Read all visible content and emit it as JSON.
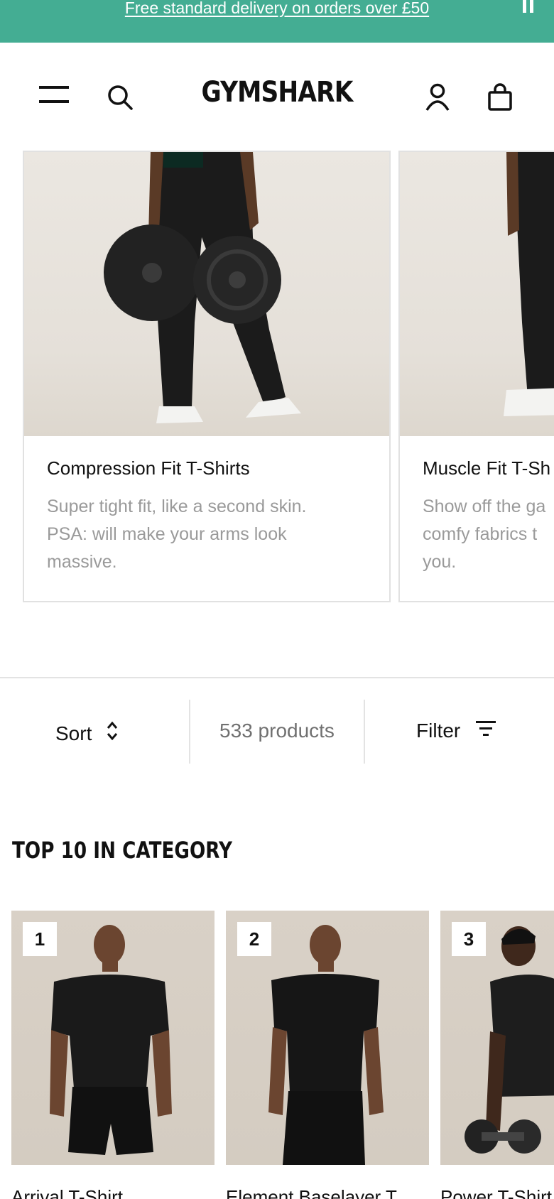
{
  "promo": {
    "text": "Free standard delivery on orders over £50"
  },
  "header": {
    "logo": "GYMSHARK"
  },
  "categories": [
    {
      "title": "Compression Fit T-Shirts",
      "desc": [
        "Super tight fit, like a second skin.",
        "PSA: will make your arms look",
        "massive."
      ]
    },
    {
      "title": "Muscle Fit T-Sh",
      "desc": [
        "Show off the ga",
        "comfy fabrics t",
        "you."
      ]
    }
  ],
  "toolbar": {
    "sort_label": "Sort",
    "count": "533 products",
    "filter_label": "Filter"
  },
  "section": {
    "title": "TOP 10 IN CATEGORY"
  },
  "products": [
    {
      "rank": "1",
      "name": "Arrival T-Shirt"
    },
    {
      "rank": "2",
      "name": "Element Baselayer T..."
    },
    {
      "rank": "3",
      "name": "Power T-Shirt"
    }
  ],
  "colors": {
    "promo_bg": "#44ad93",
    "text": "#111111",
    "muted": "#9a9a9a"
  }
}
